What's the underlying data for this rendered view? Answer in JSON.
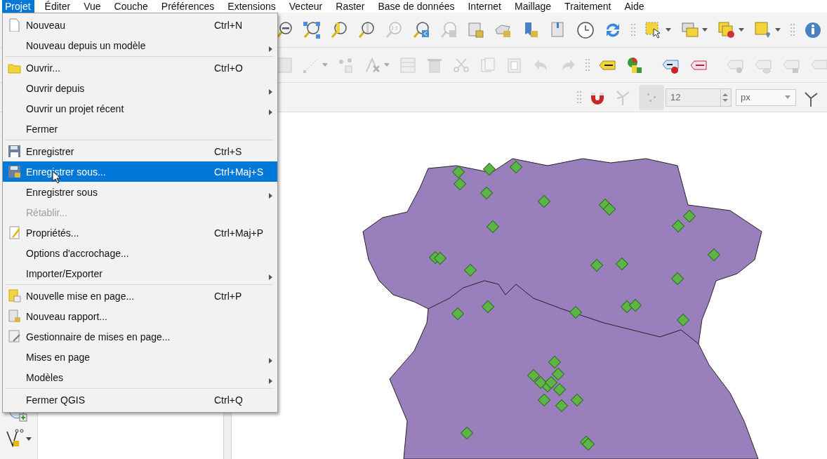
{
  "menubar": [
    {
      "label": "Projet",
      "selected": true
    },
    {
      "label": "Éditer",
      "selected": false
    },
    {
      "label": "Vue",
      "selected": false
    },
    {
      "label": "Couche",
      "selected": false
    },
    {
      "label": "Préférences",
      "selected": false
    },
    {
      "label": "Extensions",
      "selected": false
    },
    {
      "label": "Vecteur",
      "selected": false
    },
    {
      "label": "Raster",
      "selected": false
    },
    {
      "label": "Base de données",
      "selected": false
    },
    {
      "label": "Internet",
      "selected": false
    },
    {
      "label": "Maillage",
      "selected": false
    },
    {
      "label": "Traitement",
      "selected": false
    },
    {
      "label": "Aide",
      "selected": false
    }
  ],
  "project_menu": {
    "items": [
      {
        "kind": "item",
        "label": "Nouveau",
        "shortcut": "Ctrl+N",
        "submenu": false,
        "disabled": false,
        "selected": false
      },
      {
        "kind": "item",
        "label": "Nouveau depuis un modèle",
        "submenu": true,
        "disabled": false,
        "selected": false
      },
      {
        "kind": "separator"
      },
      {
        "kind": "item",
        "label": "Ouvrir...",
        "shortcut": "Ctrl+O",
        "submenu": false,
        "disabled": false,
        "selected": false
      },
      {
        "kind": "item",
        "label": "Ouvrir depuis",
        "submenu": true,
        "disabled": false,
        "selected": false
      },
      {
        "kind": "item",
        "label": "Ouvrir un projet récent",
        "submenu": true,
        "disabled": false,
        "selected": false
      },
      {
        "kind": "item",
        "label": "Fermer",
        "submenu": false,
        "disabled": false,
        "selected": false
      },
      {
        "kind": "separator"
      },
      {
        "kind": "item",
        "label": "Enregistrer",
        "shortcut": "Ctrl+S",
        "submenu": false,
        "disabled": false,
        "selected": false
      },
      {
        "kind": "item",
        "label": "Enregistrer sous...",
        "shortcut": "Ctrl+Maj+S",
        "submenu": false,
        "disabled": false,
        "selected": true
      },
      {
        "kind": "item",
        "label": "Enregistrer sous",
        "submenu": true,
        "disabled": false,
        "selected": false
      },
      {
        "kind": "item",
        "label": "Rétablir...",
        "submenu": false,
        "disabled": true,
        "selected": false
      },
      {
        "kind": "item",
        "label": "Propriétés...",
        "shortcut": "Ctrl+Maj+P",
        "submenu": false,
        "disabled": false,
        "selected": false
      },
      {
        "kind": "item",
        "label": "Options d'accrochage...",
        "submenu": false,
        "disabled": false,
        "selected": false
      },
      {
        "kind": "item",
        "label": "Importer/Exporter",
        "submenu": true,
        "disabled": false,
        "selected": false
      },
      {
        "kind": "separator"
      },
      {
        "kind": "item",
        "label": "Nouvelle mise en page...",
        "shortcut": "Ctrl+P",
        "submenu": false,
        "disabled": false,
        "selected": false
      },
      {
        "kind": "item",
        "label": "Nouveau rapport...",
        "submenu": false,
        "disabled": false,
        "selected": false
      },
      {
        "kind": "item",
        "label": "Gestionnaire de mises en page...",
        "submenu": false,
        "disabled": false,
        "selected": false
      },
      {
        "kind": "item",
        "label": "Mises en page",
        "submenu": true,
        "disabled": false,
        "selected": false
      },
      {
        "kind": "item",
        "label": "Modèles",
        "submenu": true,
        "disabled": false,
        "selected": false
      },
      {
        "kind": "separator"
      },
      {
        "kind": "item",
        "label": "Fermer QGIS",
        "shortcut": "Ctrl+Q",
        "submenu": false,
        "disabled": false,
        "selected": false
      }
    ]
  },
  "snapping_toolbar": {
    "tolerance": "12",
    "units": "px"
  }
}
